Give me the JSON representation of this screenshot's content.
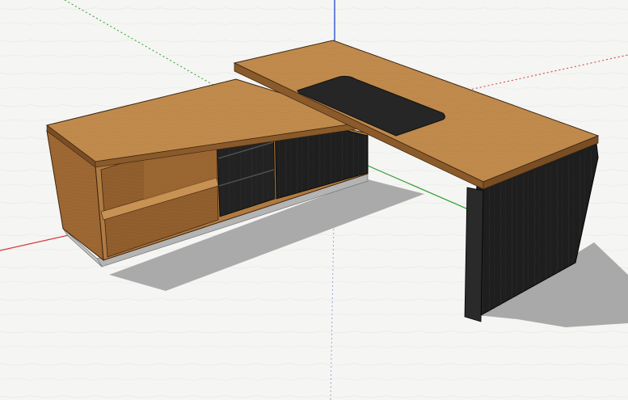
{
  "scene": {
    "model": "l-shaped-office-desk",
    "colors": {
      "background": "#f5f5f3",
      "wood_top": "#c08a4c",
      "wood_side": "#9c6632",
      "wood_edge": "#7a4e24",
      "black_panel": "#1e1e1e",
      "black_panel_light": "#2a2a2a",
      "desk_pad": "#262626",
      "base_plinth": "#b4b4b4",
      "shadow": "#a9a9a9",
      "axis_red": "#d23a3a",
      "axis_green": "#2e9e2e",
      "axis_blue": "#3050d0"
    },
    "axes": {
      "red": "x-axis",
      "green": "y-axis",
      "blue": "z-axis"
    }
  }
}
